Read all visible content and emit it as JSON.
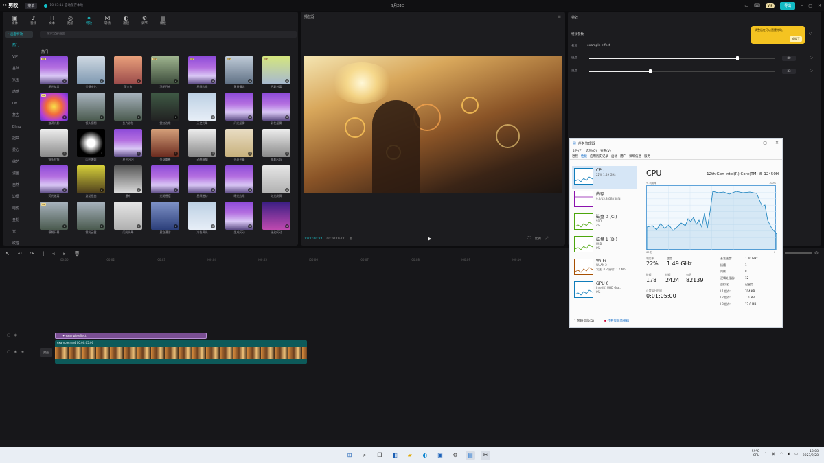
{
  "topbar": {
    "logo": "✂ 剪映",
    "menu": "菜单",
    "autosave": "10:03:11 自动保存本地",
    "title": "9月28日",
    "vip": "VIP",
    "export": "导出"
  },
  "left": {
    "tools": [
      {
        "icon": "▣",
        "label": "媒体"
      },
      {
        "icon": "♪",
        "label": "音频"
      },
      {
        "icon": "TI",
        "label": "文本"
      },
      {
        "icon": "◎",
        "label": "贴纸"
      },
      {
        "icon": "✦",
        "label": "特效"
      },
      {
        "icon": "⋈",
        "label": "转场"
      },
      {
        "icon": "◐",
        "label": "滤镜"
      },
      {
        "icon": "⚙",
        "label": "调节"
      },
      {
        "icon": "▤",
        "label": "模板"
      }
    ],
    "nav_tag": "• 画面特效",
    "nav": [
      "热门",
      "VIP",
      "基础",
      "氛围",
      "动感",
      "DV",
      "复古",
      "Bling",
      "扭曲",
      "爱心",
      "综艺",
      "漫画",
      "自然",
      "边框",
      "电影",
      "金粉",
      "光",
      "纹理"
    ],
    "search_placeholder": "搜索全部画面",
    "section": "热门",
    "effects": [
      {
        "label": "星光花月",
        "vip": true,
        "theme": "t1"
      },
      {
        "label": "关键变化",
        "vip": false,
        "theme": "t2"
      },
      {
        "label": "萤火虫",
        "vip": false,
        "theme": "t3"
      },
      {
        "label": "羽毛日夜",
        "vip": true,
        "theme": "t4"
      },
      {
        "label": "星际边缘",
        "vip": true,
        "theme": "t1"
      },
      {
        "label": "黄昏漫游",
        "vip": true,
        "theme": "t16"
      },
      {
        "label": "色彩分离",
        "vip": true,
        "theme": "t5"
      },
      {
        "label": "漩涡光影",
        "vip": true,
        "theme": "t6"
      },
      {
        "label": "镜头模糊",
        "vip": false,
        "theme": "t7"
      },
      {
        "label": "负片游移",
        "vip": false,
        "theme": "t7"
      },
      {
        "label": "霓虹边缘",
        "vip": false,
        "theme": "t8"
      },
      {
        "label": "天使光晕",
        "vip": false,
        "theme": "t9"
      },
      {
        "label": "闪光烟雾",
        "vip": false,
        "theme": "t1"
      },
      {
        "label": "彩色烟雾",
        "vip": false,
        "theme": "t1"
      },
      {
        "label": "镜头拉镜",
        "vip": false,
        "theme": "t10"
      },
      {
        "label": "闪光爆炸",
        "vip": false,
        "theme": "t11"
      },
      {
        "label": "星光闪闪",
        "vip": false,
        "theme": "t1"
      },
      {
        "label": "分身重叠",
        "vip": false,
        "theme": "t12"
      },
      {
        "label": "动感模糊",
        "vip": false,
        "theme": "t10"
      },
      {
        "label": "光斑光晕",
        "vip": false,
        "theme": "t13"
      },
      {
        "label": "电影闪烁",
        "vip": false,
        "theme": "t10"
      },
      {
        "label": "荧光迷离",
        "vip": false,
        "theme": "t1"
      },
      {
        "label": "波动扭曲",
        "vip": false,
        "theme": "t14"
      },
      {
        "label": "瀑布",
        "vip": false,
        "theme": "t15"
      },
      {
        "label": "光斑摇摆",
        "vip": false,
        "theme": "t1"
      },
      {
        "label": "星际迷幻",
        "vip": false,
        "theme": "t1"
      },
      {
        "label": "曝光边缘",
        "vip": false,
        "theme": "t1"
      },
      {
        "label": "炫光刷屏",
        "vip": false,
        "theme": "t18"
      },
      {
        "label": "模糊开幕",
        "vip": true,
        "theme": "t7"
      },
      {
        "label": "雾光云霞",
        "vip": false,
        "theme": "t7"
      },
      {
        "label": "闪光光晕",
        "vip": false,
        "theme": "t18"
      },
      {
        "label": "星空漫游",
        "vip": false,
        "theme": "t17"
      },
      {
        "label": "冷色调光",
        "vip": false,
        "theme": "t9"
      },
      {
        "label": "生成闪动",
        "vip": false,
        "theme": "t1"
      },
      {
        "label": "迷幻闪动",
        "vip": false,
        "theme": "t19"
      }
    ]
  },
  "player": {
    "title": "播放器",
    "time_current": "00:00:00:24",
    "time_total": "00:00:05:00",
    "ratio": "比例"
  },
  "inspector": {
    "title": "特效",
    "section": "特效参数",
    "name_label": "名称",
    "name_value": "example effect",
    "params": [
      {
        "label": "强度",
        "value": "80",
        "level": 0.8
      },
      {
        "label": "速度",
        "value": "33",
        "level": 0.33
      }
    ],
    "tip_text": "调整后在可以直接拖动，",
    "tip_ok": "知道了"
  },
  "timeline": {
    "ticks": [
      "00:00",
      "|00:02",
      "|00:03",
      "|00:04",
      "|00:05",
      "|00:06",
      "|00:07",
      "|00:08",
      "|00:09",
      "|00:10"
    ],
    "effect_clip": "✦ example effect",
    "video_clip": "example.mp4  00:00:05:00",
    "cover": "封面"
  },
  "taskmgr": {
    "title": "任务管理器",
    "menu": [
      "文件(F)",
      "选项(O)",
      "查看(V)"
    ],
    "tabs": [
      "进程",
      "性能",
      "应用历史记录",
      "启动",
      "用户",
      "详细信息",
      "服务"
    ],
    "devices": [
      {
        "name": "CPU",
        "sub1": "22%  1.49 GHz",
        "sub2": "",
        "sub3": "",
        "color": "#117dbb"
      },
      {
        "name": "内存",
        "sub1": "9.2/15.8 GB (58%)",
        "sub2": "",
        "sub3": "",
        "color": "#8b12ae"
      },
      {
        "name": "磁盘 0 (C:)",
        "sub1": "SSD",
        "sub2": "4%",
        "sub3": "",
        "color": "#4da60c"
      },
      {
        "name": "磁盘 1 (D:)",
        "sub1": "USB",
        "sub2": "0%",
        "sub3": "",
        "color": "#4da60c"
      },
      {
        "name": "Wi-Fi",
        "sub1": "WLAN 2",
        "sub2": "发送: 0.2  接收: 1.7 Mb",
        "sub3": "",
        "color": "#a74f01"
      },
      {
        "name": "GPU 0",
        "sub1": "Intel(R) UHD Gra...",
        "sub2": "0%",
        "sub3": "",
        "color": "#117dbb"
      }
    ],
    "main_title": "CPU",
    "model": "12th Gen Intel(R) Core(TM) i5-12450H",
    "util_label": "% 利用率",
    "util_max": "100%",
    "time_left": "60 秒",
    "time_right": "0",
    "util_value": "22%",
    "util_caption": "利用率",
    "speed_caption": "速度",
    "speed_value": "1.49 GHz",
    "proc_caption": "进程",
    "proc_value": "178",
    "thread_caption": "线程",
    "thread_value": "2424",
    "handle_caption": "句柄",
    "handle_value": "82139",
    "uptime_caption": "正常运行时间",
    "uptime_value": "0:01:05:00",
    "specs": [
      {
        "k": "基准速度:",
        "v": "1.10 GHz"
      },
      {
        "k": "插槽:",
        "v": "1"
      },
      {
        "k": "内核:",
        "v": "8"
      },
      {
        "k": "逻辑处理器:",
        "v": "12"
      },
      {
        "k": "虚拟化:",
        "v": "已启用"
      },
      {
        "k": "L1 缓存:",
        "v": "704 KB"
      },
      {
        "k": "L2 缓存:",
        "v": "7.0 MB"
      },
      {
        "k": "L3 缓存:",
        "v": "12.0 MB"
      }
    ],
    "footer_less": "简略信息(D)",
    "footer_link": "打开资源监视器"
  },
  "taskbar": {
    "temp": "59°C",
    "temp_label": "CPU",
    "lang": "英",
    "time": "18:08",
    "date": "2023/9/28"
  }
}
